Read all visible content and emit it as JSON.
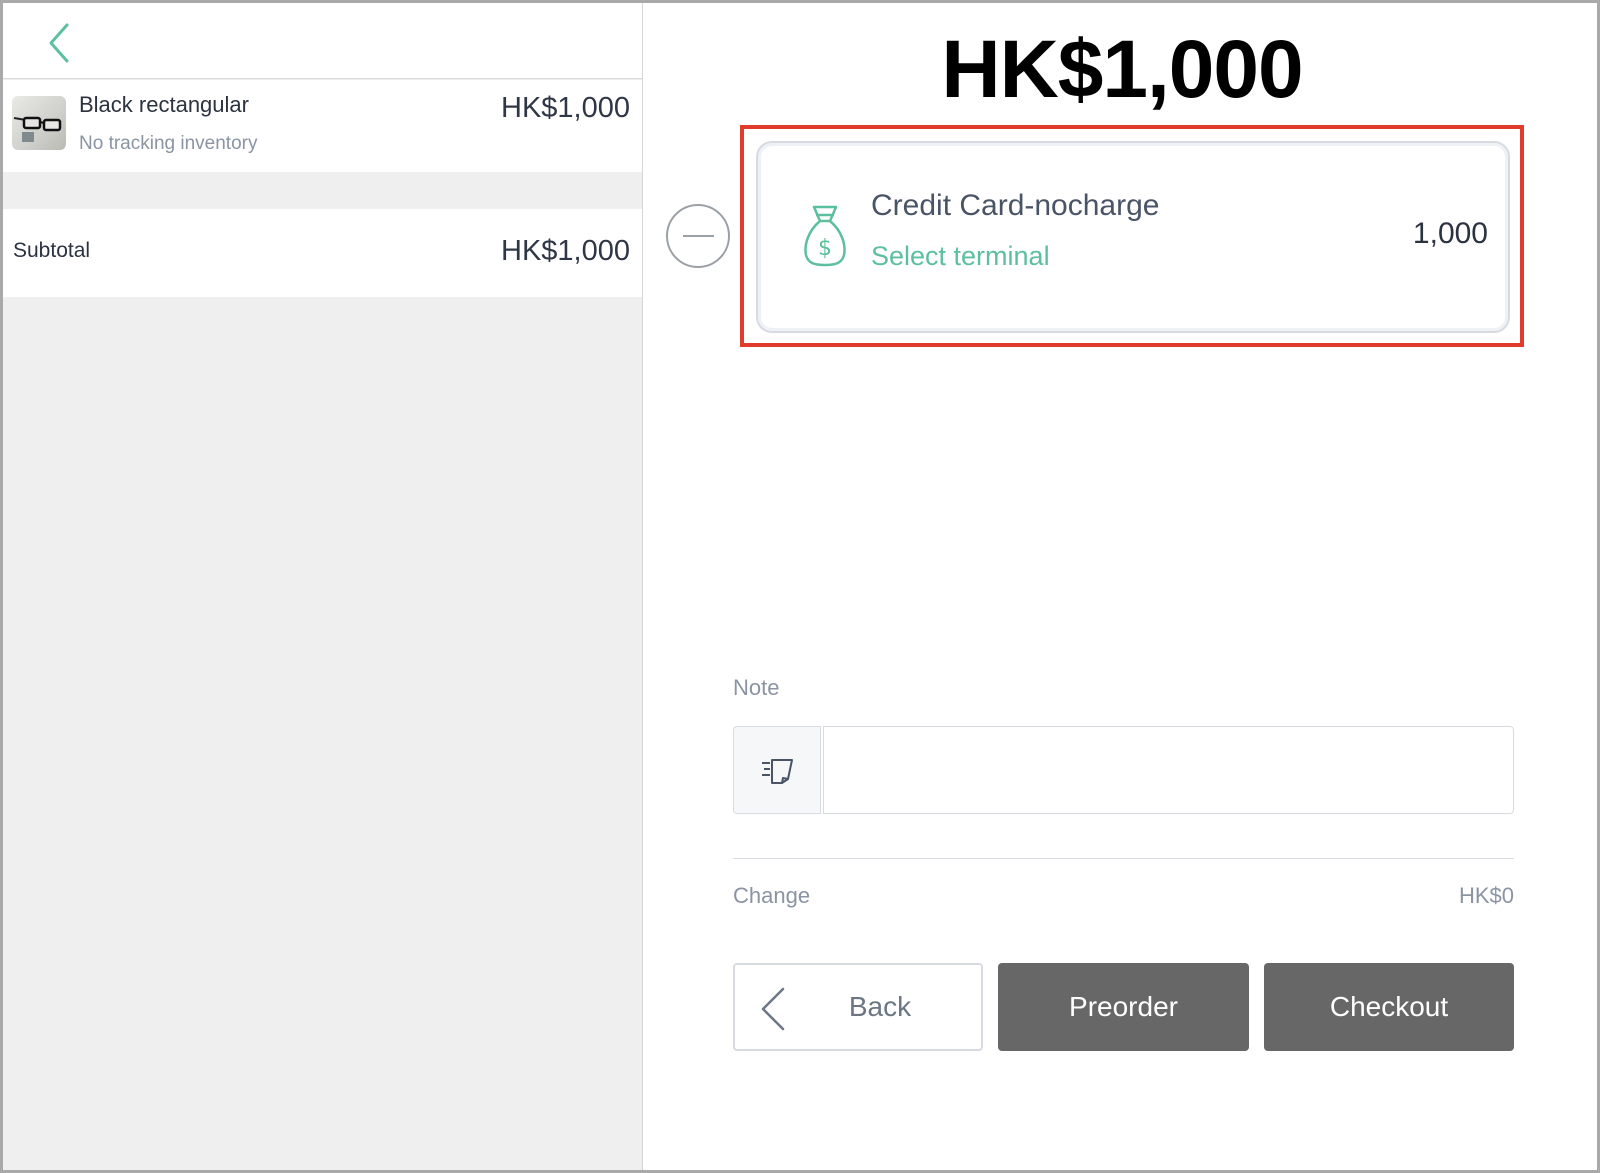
{
  "cart": {
    "items": [
      {
        "name": "Black rectangular",
        "subtitle": "No tracking inventory",
        "price": "HK$1,000",
        "thumbnail_icon": "eyeglasses-icon"
      }
    ],
    "subtotal_label": "Subtotal",
    "subtotal_value": "HK$1,000"
  },
  "checkout": {
    "total": "HK$1,000",
    "payment": {
      "method": "Credit Card-nocharge",
      "action": "Select terminal",
      "amount": "1,000",
      "icon": "money-bag-icon"
    },
    "note_label": "Note",
    "note_value": "",
    "change_label": "Change",
    "change_value": "HK$0",
    "buttons": {
      "back": "Back",
      "preorder": "Preorder",
      "checkout": "Checkout"
    }
  },
  "colors": {
    "accent_green": "#5cbf9d",
    "highlight_red": "#e03b2c",
    "button_dark": "#676767"
  }
}
